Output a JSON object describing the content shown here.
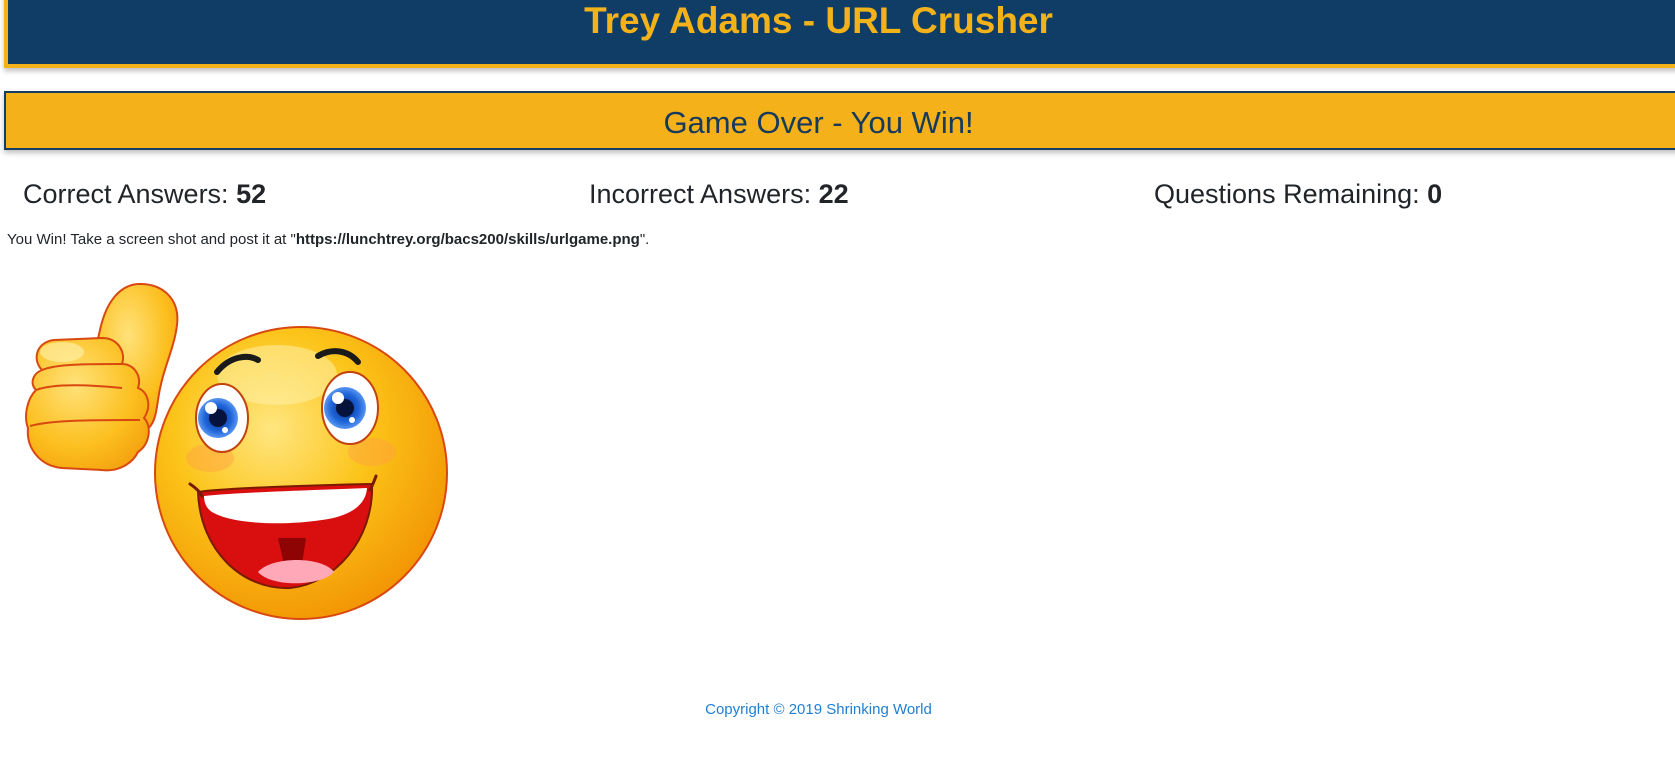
{
  "header": {
    "title": "Trey Adams - URL Crusher"
  },
  "banner": {
    "status": "Game Over - You Win!"
  },
  "stats": {
    "correct_label": "Correct Answers:",
    "correct_value": "52",
    "incorrect_label": "Incorrect Answers:",
    "incorrect_value": "22",
    "remaining_label": "Questions Remaining:",
    "remaining_value": "0"
  },
  "instruction": {
    "prefix": "You Win! Take a screen shot and post it at \"",
    "url": "https://lunchtrey.org/bacs200/skills/urlgame.png",
    "suffix": "\"."
  },
  "image": {
    "icon": "thumbs-up-smiley-icon"
  },
  "footer": {
    "copyright": "Copyright © 2019 Shrinking World"
  },
  "colors": {
    "header_bg": "#0f3d66",
    "accent": "#f3b21a",
    "banner_text": "#173a5c",
    "link": "#1f7fd3"
  }
}
